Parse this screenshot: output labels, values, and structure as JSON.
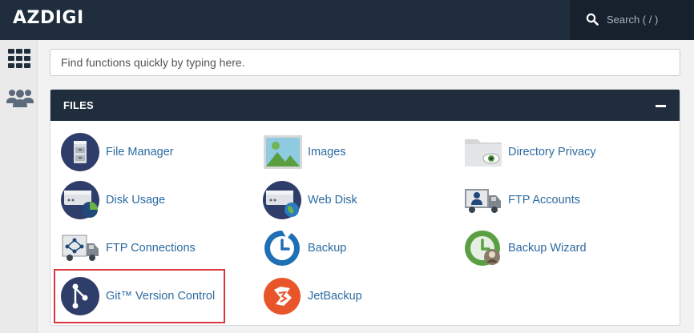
{
  "app": {
    "logo": "AZDIGI"
  },
  "topsearch": {
    "placeholder": "Search ( / )"
  },
  "function_search": {
    "placeholder": "Find functions quickly by typing here."
  },
  "section": {
    "title": "FILES"
  },
  "items": [
    {
      "label": "File Manager",
      "icon": "file-manager-icon"
    },
    {
      "label": "Images",
      "icon": "images-icon"
    },
    {
      "label": "Directory Privacy",
      "icon": "directory-privacy-icon"
    },
    {
      "label": "Disk Usage",
      "icon": "disk-usage-icon"
    },
    {
      "label": "Web Disk",
      "icon": "web-disk-icon"
    },
    {
      "label": "FTP Accounts",
      "icon": "ftp-accounts-icon"
    },
    {
      "label": "FTP Connections",
      "icon": "ftp-connections-icon"
    },
    {
      "label": "Backup",
      "icon": "backup-icon"
    },
    {
      "label": "Backup Wizard",
      "icon": "backup-wizard-icon"
    },
    {
      "label": "Git™ Version Control",
      "icon": "git-icon"
    },
    {
      "label": "JetBackup",
      "icon": "jetbackup-icon"
    }
  ],
  "colors": {
    "header": "#1f2d3d",
    "link": "#2c6aa0",
    "highlight": "#d9363e"
  }
}
